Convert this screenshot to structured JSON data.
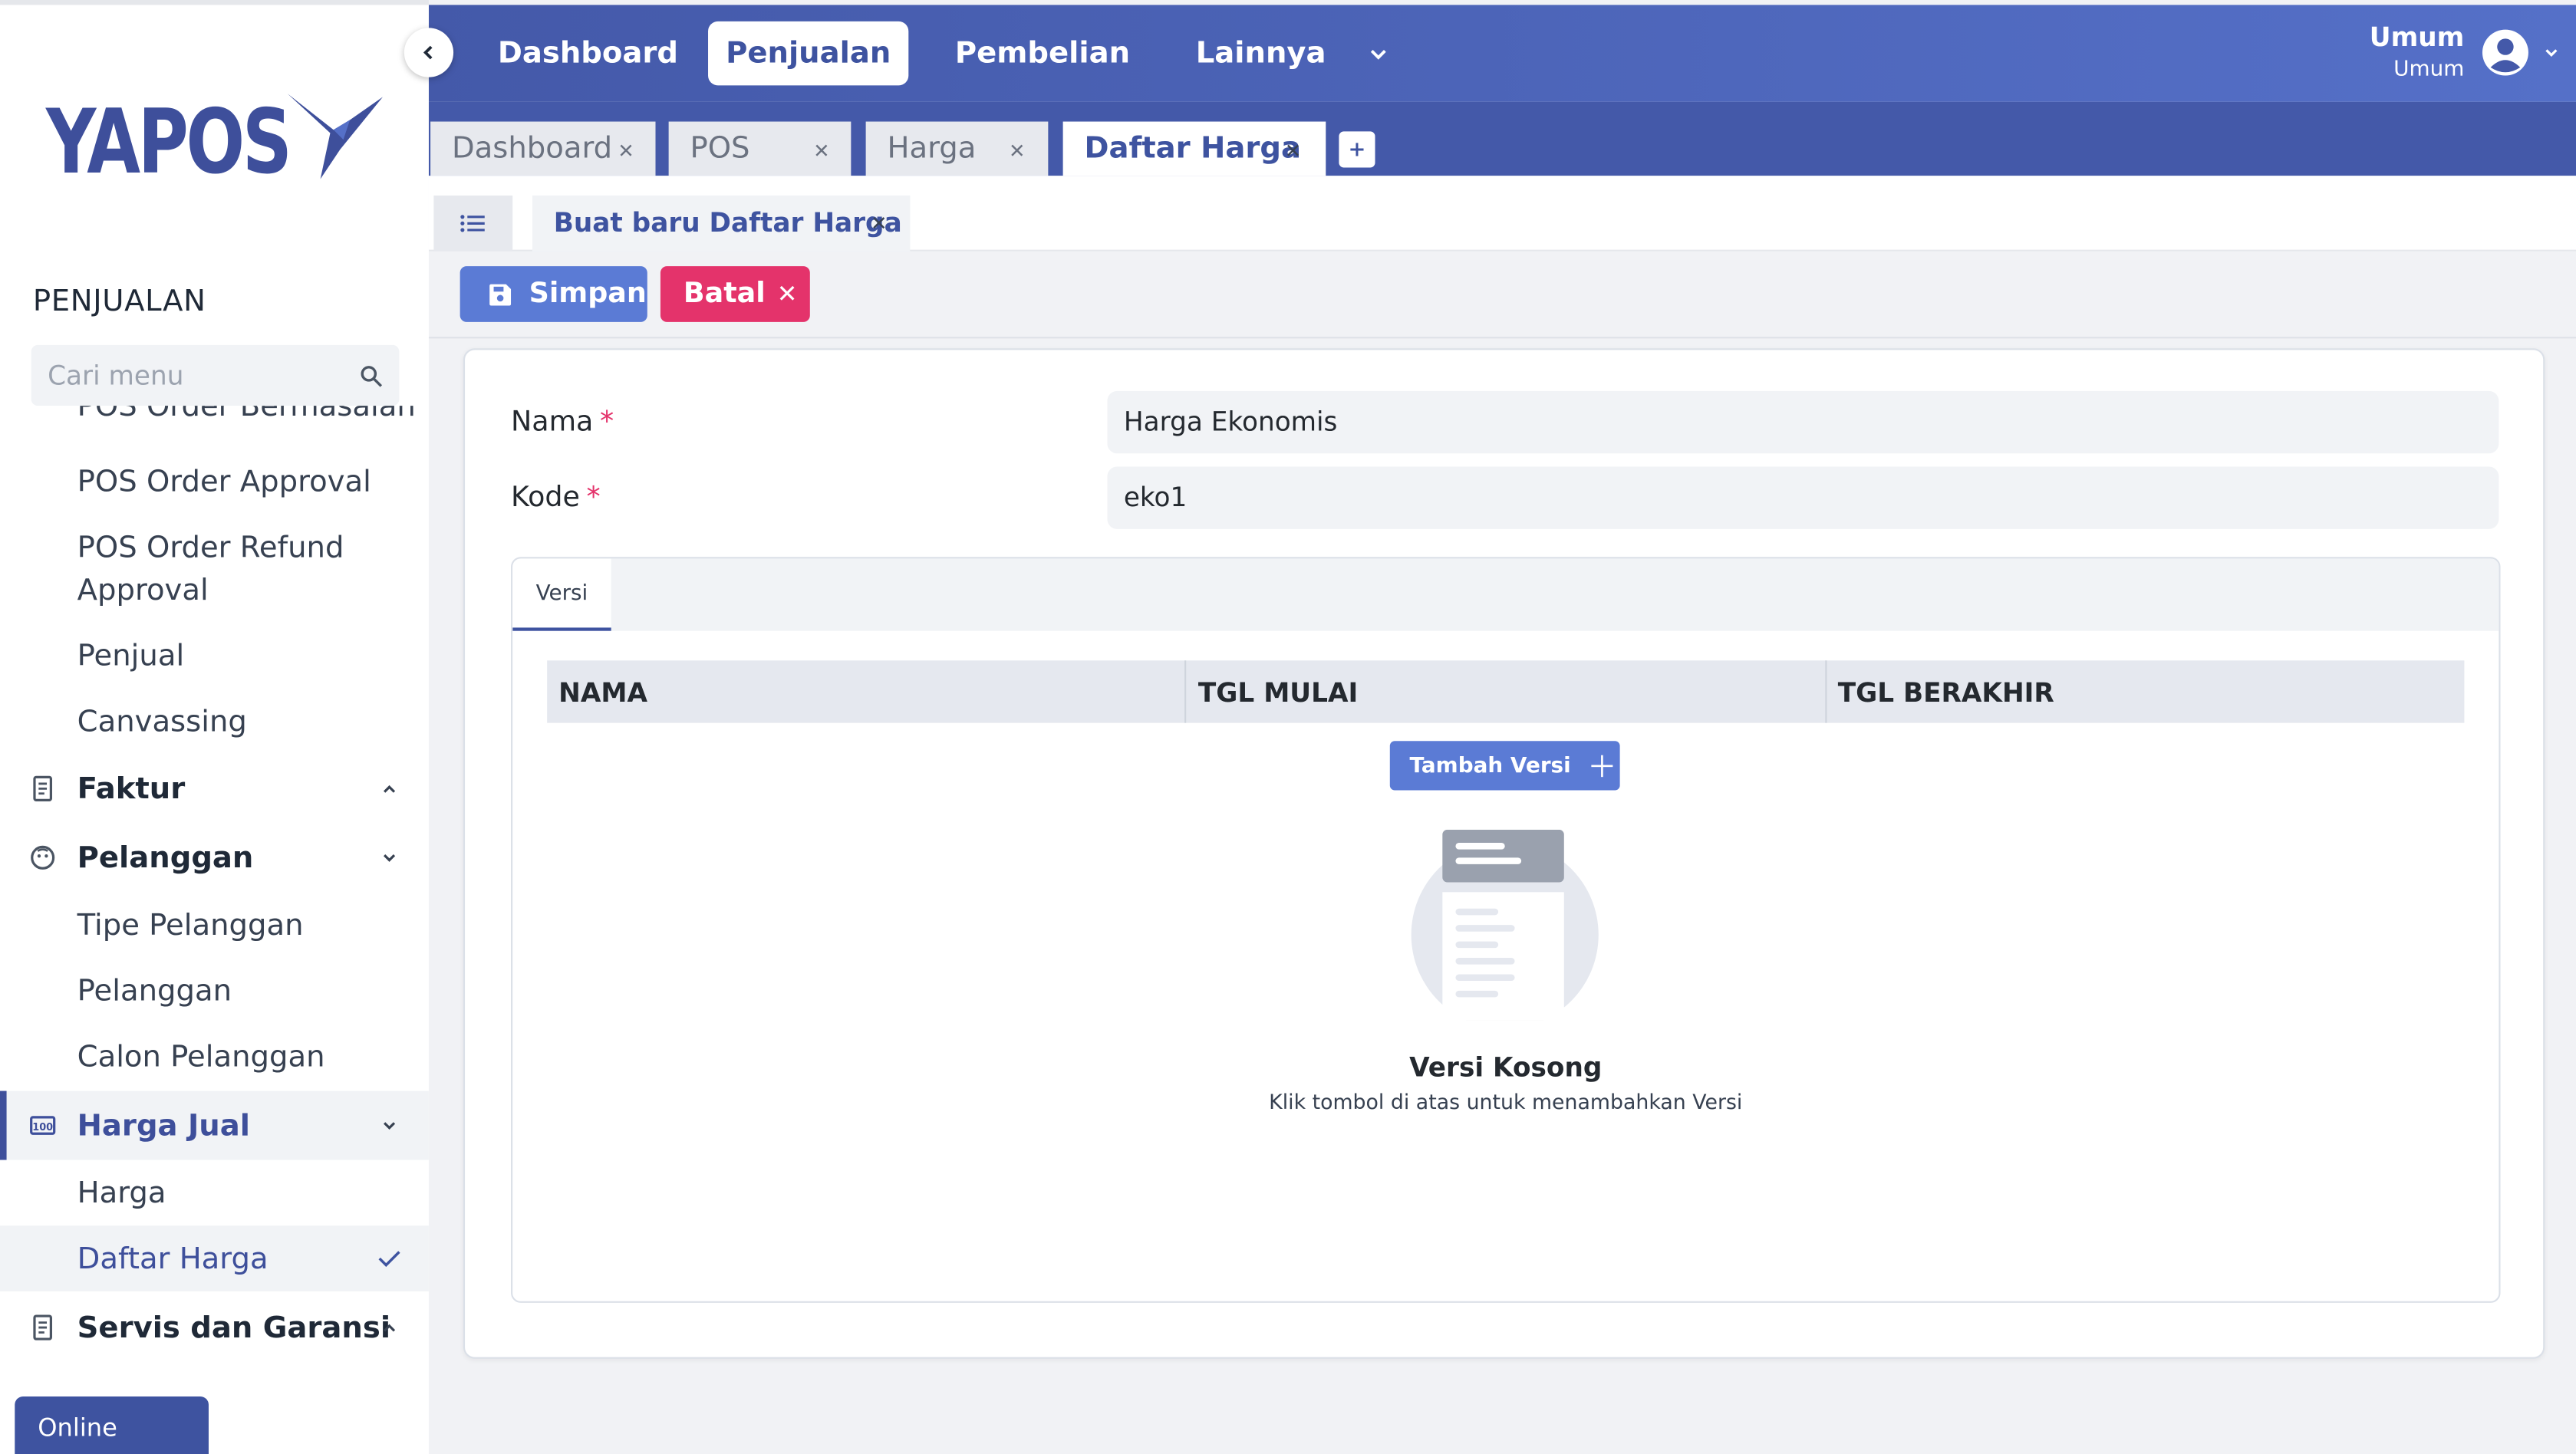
{
  "brand": {
    "name": "YAPOS"
  },
  "sidebar": {
    "section_title": "PENJUALAN",
    "search_placeholder": "Cari menu",
    "items": [
      {
        "label": "POS Order Bermasalah"
      },
      {
        "label": "POS Order Approval"
      },
      {
        "label": "POS Order Refund Approval"
      },
      {
        "label": "Penjual"
      },
      {
        "label": "Canvassing"
      },
      {
        "label": "Faktur"
      },
      {
        "label": "Pelanggan"
      },
      {
        "label": "Tipe Pelanggan"
      },
      {
        "label": "Pelanggan"
      },
      {
        "label": "Calon Pelanggan"
      },
      {
        "label": "Harga Jual"
      },
      {
        "label": "Harga"
      },
      {
        "label": "Daftar Harga"
      },
      {
        "label": "Servis dan Garansi"
      }
    ],
    "status": "Online"
  },
  "topnav": {
    "items": [
      {
        "label": "Dashboard"
      },
      {
        "label": "Penjualan"
      },
      {
        "label": "Pembelian"
      },
      {
        "label": "Lainnya"
      }
    ],
    "user": {
      "name": "Umum",
      "role": "Umum"
    }
  },
  "tabs": [
    {
      "label": "Dashboard"
    },
    {
      "label": "POS"
    },
    {
      "label": "Harga"
    },
    {
      "label": "Daftar Harga"
    }
  ],
  "subtab": {
    "label": "Buat baru Daftar Harga"
  },
  "actions": {
    "save": "Simpan",
    "cancel": "Batal"
  },
  "form": {
    "nama_label": "Nama",
    "nama_value": "Harga Ekonomis",
    "kode_label": "Kode",
    "kode_value": "eko1",
    "required_mark": "*"
  },
  "versi": {
    "tab_label": "Versi",
    "columns": [
      "NAMA",
      "TGL MULAI",
      "TGL BERAKHIR"
    ],
    "add_button": "Tambah Versi",
    "empty_title": "Versi Kosong",
    "empty_subtitle": "Klik tombol di atas untuk menambahkan Versi"
  }
}
